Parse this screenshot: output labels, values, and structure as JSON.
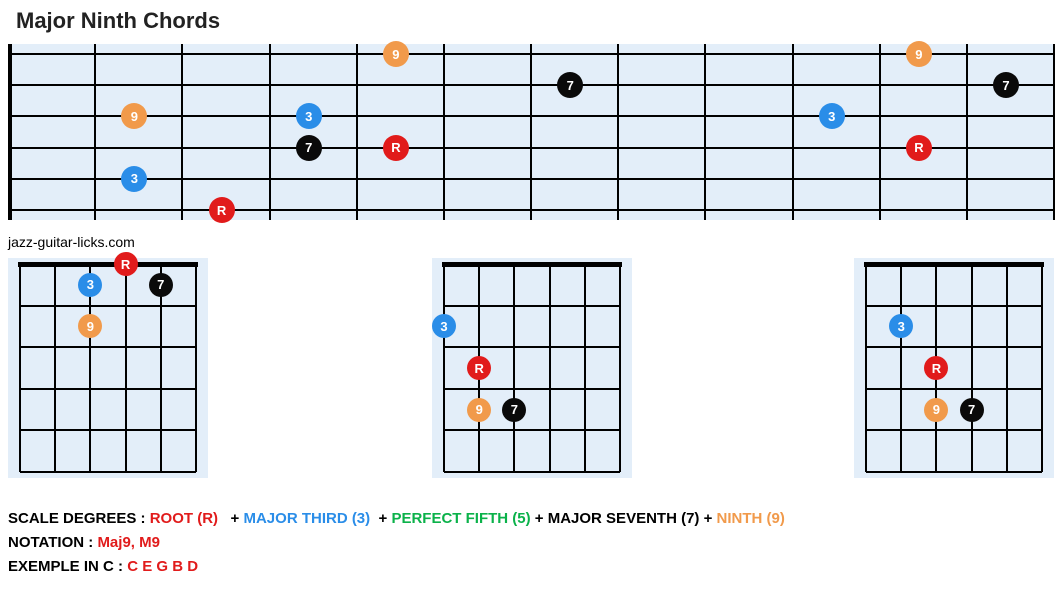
{
  "title": "Major Ninth Chords",
  "attribution": "jazz-guitar-licks.com",
  "note_labels": {
    "root": "R",
    "third": "3",
    "fifth": "5",
    "seventh": "7",
    "ninth": "9"
  },
  "colors": {
    "root": "#e11b1b",
    "third": "#2a8de8",
    "fifth": "#0bb24a",
    "seventh": "#0a0a0a",
    "ninth": "#f19a4b"
  },
  "main_fretboard": {
    "strings": 6,
    "frets": 12,
    "notes": [
      {
        "string": 6,
        "fret": 3,
        "tone": "root"
      },
      {
        "string": 5,
        "fret": 2,
        "tone": "third"
      },
      {
        "string": 3,
        "fret": 2,
        "tone": "ninth"
      },
      {
        "string": 4,
        "fret": 4,
        "tone": "seventh"
      },
      {
        "string": 3,
        "fret": 4,
        "tone": "third"
      },
      {
        "string": 4,
        "fret": 5,
        "tone": "root"
      },
      {
        "string": 1,
        "fret": 5,
        "tone": "ninth"
      },
      {
        "string": 2,
        "fret": 7,
        "tone": "seventh"
      },
      {
        "string": 3,
        "fret": 10,
        "tone": "third"
      },
      {
        "string": 4,
        "fret": 11,
        "tone": "root"
      },
      {
        "string": 1,
        "fret": 11,
        "tone": "ninth"
      },
      {
        "string": 2,
        "fret": 12,
        "tone": "seventh"
      }
    ]
  },
  "chord_shapes": [
    {
      "strings": 6,
      "frets": 5,
      "notes": [
        {
          "string": 4,
          "fret": 0,
          "tone": "root"
        },
        {
          "string": 3,
          "fret": 1,
          "tone": "third"
        },
        {
          "string": 5,
          "fret": 1,
          "tone": "seventh"
        },
        {
          "string": 3,
          "fret": 2,
          "tone": "ninth"
        }
      ]
    },
    {
      "strings": 6,
      "frets": 5,
      "notes": [
        {
          "string": 1,
          "fret": 2,
          "tone": "third"
        },
        {
          "string": 2,
          "fret": 3,
          "tone": "root"
        },
        {
          "string": 2,
          "fret": 4,
          "tone": "ninth"
        },
        {
          "string": 3,
          "fret": 4,
          "tone": "seventh"
        }
      ]
    },
    {
      "strings": 6,
      "frets": 5,
      "notes": [
        {
          "string": 2,
          "fret": 2,
          "tone": "third"
        },
        {
          "string": 3,
          "fret": 3,
          "tone": "root"
        },
        {
          "string": 3,
          "fret": 4,
          "tone": "ninth"
        },
        {
          "string": 4,
          "fret": 4,
          "tone": "seventh"
        }
      ]
    }
  ],
  "legend": {
    "scale_label": "SCALE DEGREES :",
    "root": "ROOT (R)",
    "plus": "+",
    "third": "MAJOR THIRD (3)",
    "fifth": "PERFECT FIFTH (5)",
    "seventh": "MAJOR SEVENTH (7)",
    "ninth": "NINTH (9)",
    "notation_label": "NOTATION :",
    "notation_value": "Maj9, M9",
    "example_label": "EXEMPLE IN C :",
    "example_value": "C E G B D"
  }
}
